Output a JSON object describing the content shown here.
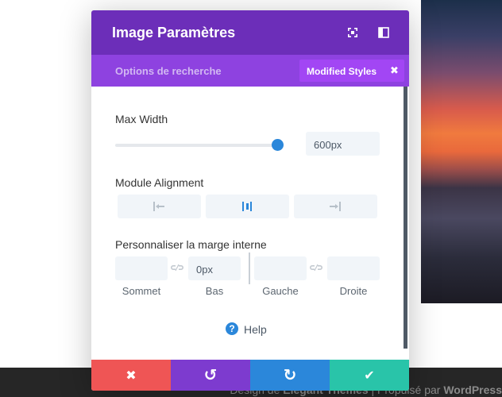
{
  "background": {
    "footer_prefix": "Design de",
    "footer_brand": "Elegant Themes",
    "footer_separator": "|",
    "footer_powered": "Propulsé par",
    "footer_platform": "WordPress"
  },
  "modal": {
    "title": "Image Paramètres",
    "header_icons": [
      "expand-icon",
      "sidebar-toggle-icon"
    ],
    "search_options_label": "Options de recherche",
    "modified_styles_label": "Modified Styles",
    "modified_styles_close": "✖",
    "max_width": {
      "label": "Max Width",
      "value": "600px",
      "slider_fraction": 0.98
    },
    "module_alignment": {
      "label": "Module Alignment",
      "options": [
        "align-left-icon",
        "align-center-icon",
        "align-right-icon"
      ],
      "selected": "align-center-icon"
    },
    "padding": {
      "label": "Personnaliser la marge interne",
      "fields": [
        {
          "label": "Sommet",
          "value": ""
        },
        {
          "label": "Bas",
          "value": "0px"
        },
        {
          "label": "Gauche",
          "value": ""
        },
        {
          "label": "Droite",
          "value": ""
        }
      ]
    },
    "help_label": "Help",
    "actions": {
      "cancel": "✖",
      "undo": "↺",
      "redo": "↻",
      "save": "✔"
    },
    "colors": {
      "header": "#6c2eb9",
      "tabbar": "#8e42e0",
      "accent": "#2b87da",
      "cancel": "#ef5555",
      "undo": "#7d3bcf",
      "redo": "#2b87da",
      "save": "#29c4a9"
    }
  }
}
